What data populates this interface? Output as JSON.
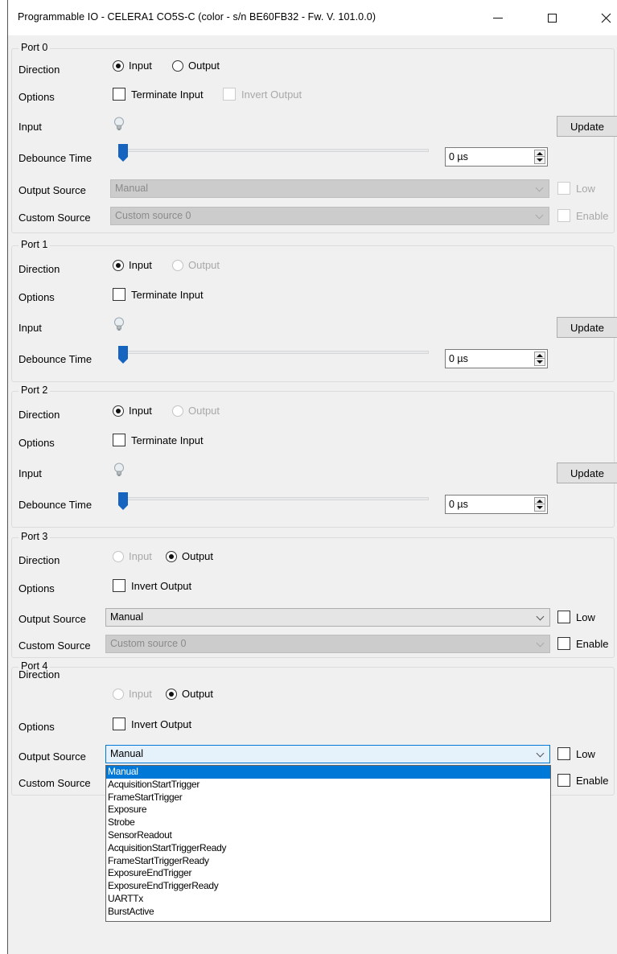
{
  "window": {
    "title": "Programmable IO - CELERA1 CO5S-C (color - s/n BE60FB32 - Fw. V. 101.0.0)",
    "controls": {
      "minimize": "minimize-icon",
      "maximize": "maximize-icon",
      "close": "close-icon"
    }
  },
  "labels": {
    "direction": "Direction",
    "options": "Options",
    "input": "Input",
    "debounce": "Debounce Time",
    "output_source": "Output Source",
    "custom_source": "Custom Source",
    "radio_input": "Input",
    "radio_output": "Output",
    "terminate_input": "Terminate Input",
    "invert_output": "Invert Output",
    "update": "Update",
    "low": "Low",
    "enable": "Enable"
  },
  "ports": [
    {
      "title": "Port 0",
      "debounce_value": "0 µs",
      "output_source": "Manual",
      "custom_source": "Custom source 0",
      "direction": "Input"
    },
    {
      "title": "Port 1",
      "debounce_value": "0 µs",
      "direction": "Input"
    },
    {
      "title": "Port 2",
      "debounce_value": "0 µs",
      "direction": "Input"
    },
    {
      "title": "Port 3",
      "output_source": "Manual",
      "custom_source": "Custom source 0",
      "direction": "Output"
    },
    {
      "title": "Port 4",
      "output_source": "Manual",
      "direction": "Output"
    }
  ],
  "dropdown": {
    "selected": "Manual",
    "options": [
      "Manual",
      "AcquisitionStartTrigger",
      "FrameStartTrigger",
      "Exposure",
      "Strobe",
      "SensorReadout",
      "AcquisitionStartTriggerReady",
      "FrameStartTriggerReady",
      "ExposureEndTrigger",
      "ExposureEndTriggerReady",
      "UARTTx",
      "BurstActive"
    ]
  },
  "colors": {
    "accent": "#0078d7",
    "window_bg": "#f0f0f0",
    "slider_thumb": "#1565c0"
  },
  "icons": {
    "input_indicator": "lightbulb-icon",
    "dropdown": "chevron-down-icon"
  }
}
